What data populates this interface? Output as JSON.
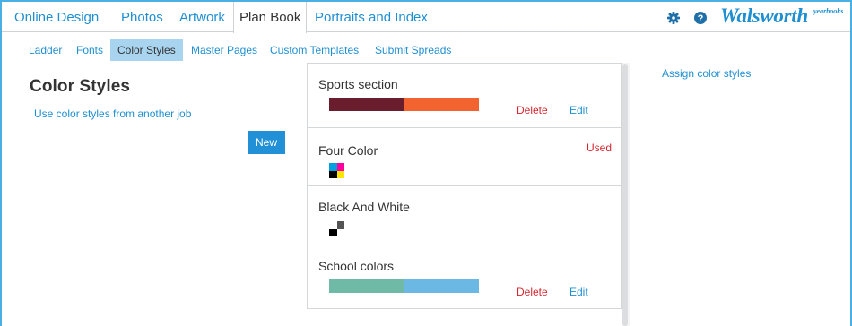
{
  "top_nav": {
    "tabs": [
      "Online Design",
      "Photos",
      "Artwork",
      "Plan Book",
      "Portraits and Index"
    ],
    "active": "Plan Book"
  },
  "brand": {
    "logo": "Walsworth",
    "logo_sup": "yearbooks"
  },
  "icons": {
    "settings": "gear-icon",
    "help": "question-icon"
  },
  "sub_nav": {
    "items": [
      "Ladder",
      "Fonts",
      "Color Styles",
      "Master Pages",
      "Custom Templates",
      "Submit Spreads"
    ],
    "active": "Color Styles"
  },
  "left": {
    "title": "Color Styles",
    "link": "Use color styles from another job",
    "new_button": "New"
  },
  "styles": [
    {
      "name": "Sports section",
      "colors": [
        "#6a1e2d",
        "#f26330"
      ],
      "actions": [
        "Delete",
        "Edit"
      ]
    },
    {
      "name": "Four Color",
      "colors": [
        "#00a0e0",
        "#ff00a0",
        "#ffe600",
        "#000000"
      ],
      "status": "Used"
    },
    {
      "name": "Black And White",
      "colors": [
        "#ffffff",
        "#555555",
        "#000000",
        "#ffffff"
      ]
    },
    {
      "name": "School colors",
      "colors": [
        "#6fbaa6",
        "#6cb8e4"
      ],
      "actions": [
        "Delete",
        "Edit"
      ]
    }
  ],
  "right": {
    "assign_link": "Assign color styles"
  },
  "theme": {
    "accent": "#1f8fd2",
    "danger": "#d8252f",
    "frame": "#4ab0e4"
  }
}
